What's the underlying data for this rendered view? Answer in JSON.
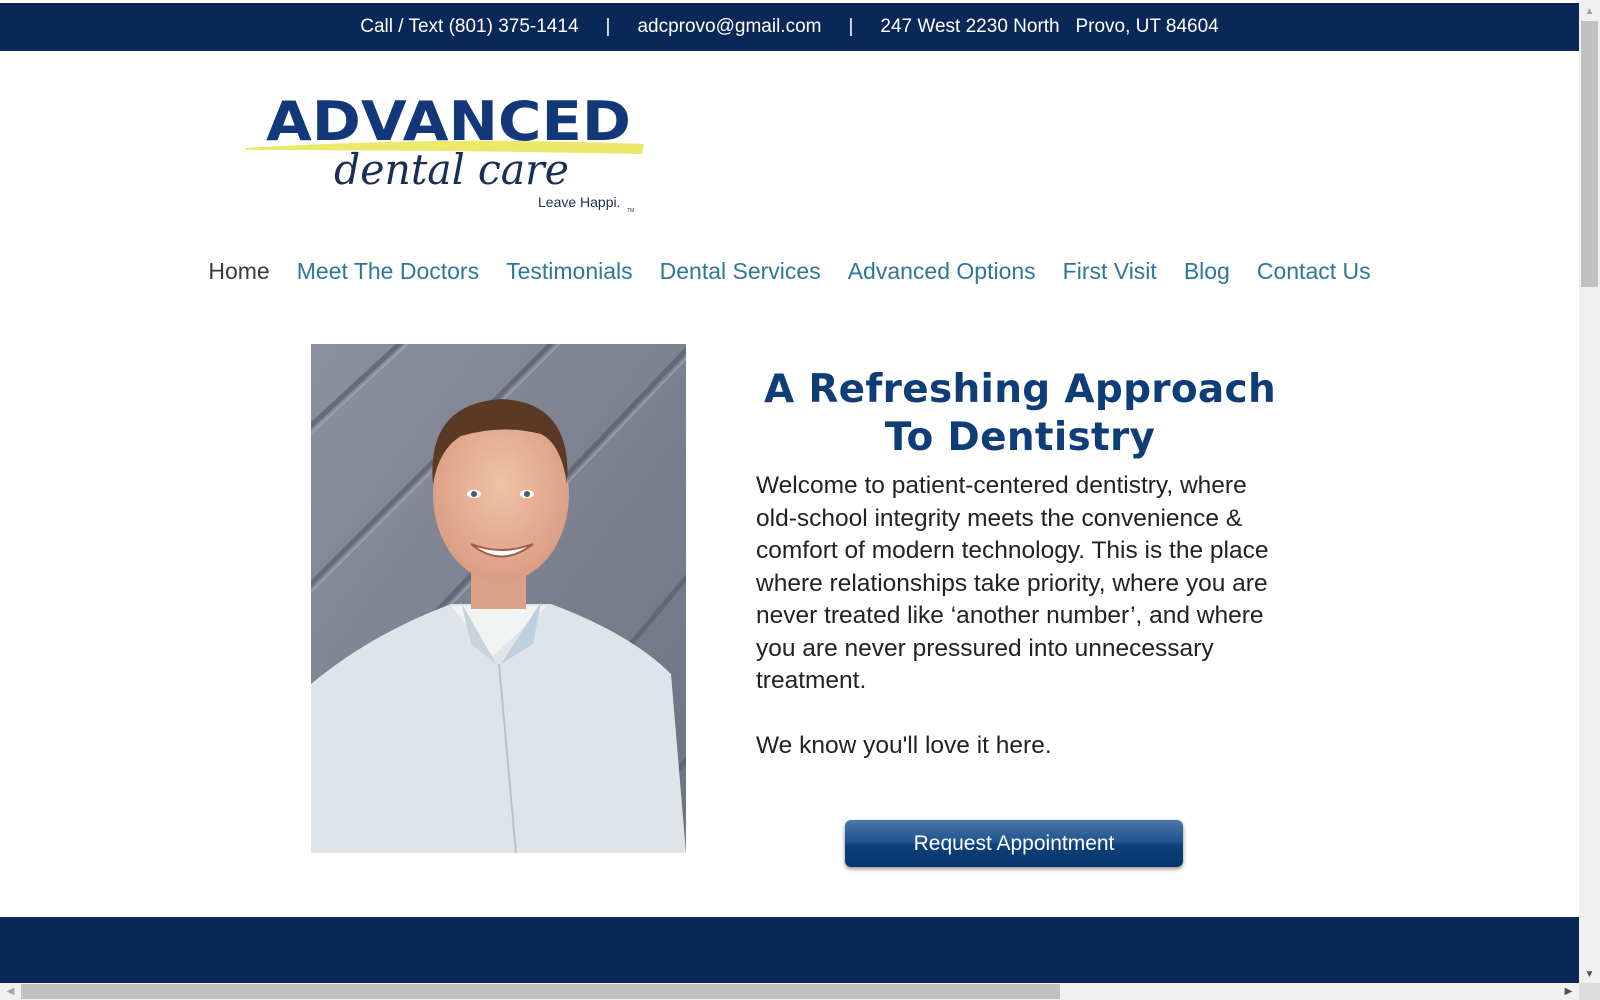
{
  "topbar": {
    "phone": "Call / Text (801) 375-1414",
    "separator": "|",
    "email": "adcprovo@gmail.com",
    "address": "247 West 2230 North   Provo, UT 84604"
  },
  "logo": {
    "word": "ADVANCED",
    "script": "dental care",
    "tagline": "Leave Happi.",
    "trademark": "TM",
    "colors": {
      "navy": "#12387a",
      "swoosh": "#ece86a"
    }
  },
  "nav": {
    "items": [
      {
        "label": "Home",
        "active": true
      },
      {
        "label": "Meet The Doctors"
      },
      {
        "label": "Testimonials"
      },
      {
        "label": "Dental Services"
      },
      {
        "label": "Advanced Options"
      },
      {
        "label": "First Visit"
      },
      {
        "label": "Blog"
      },
      {
        "label": "Contact Us"
      }
    ]
  },
  "hero": {
    "headline_line1": "A Refreshing Approach",
    "headline_line2": "To Dentistry",
    "paragraph1": "Welcome to patient-centered dentistry, where old-school integrity meets the convenience & comfort of modern technology. This is the place where relationships take priority, where you are never treated like ‘another number’, and where you are never pressured into unnecessary treatment.",
    "paragraph2": "We know you'll love it here.",
    "cta_label": "Request Appointment",
    "photo_alt": "Doctor portrait"
  },
  "theme": {
    "navy": "#0a2857",
    "heading": "#0f3d78",
    "link": "#2f7797"
  }
}
